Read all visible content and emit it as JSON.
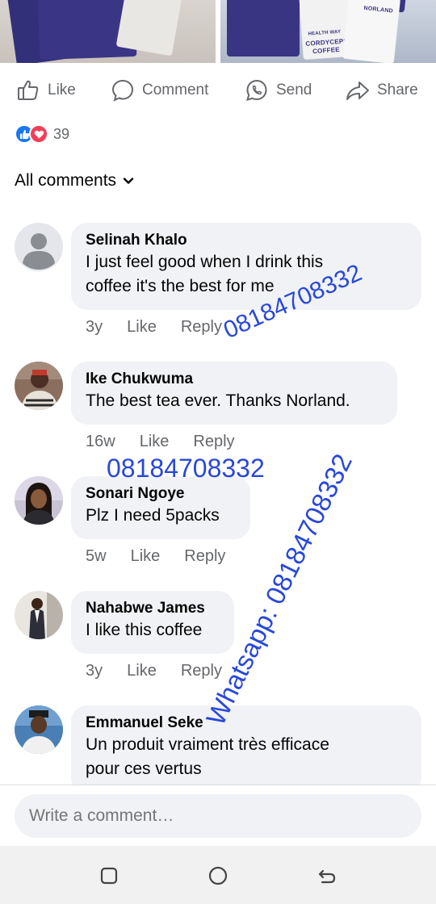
{
  "photos": {
    "right_pack_labels": [
      "NORLAND",
      "HEALTH WAY",
      "CORDYCEPS",
      "COFFEE"
    ]
  },
  "actions": {
    "like": "Like",
    "comment": "Comment",
    "send": "Send",
    "share": "Share"
  },
  "reactions": {
    "count": "39",
    "types": [
      "like",
      "love"
    ]
  },
  "comments_header": {
    "label": "All comments"
  },
  "comments": [
    {
      "name": "Selinah Khalo",
      "text_lines": [
        "I just feel good when I drink this",
        "coffee it's the best for me"
      ],
      "time": "3y",
      "like": "Like",
      "reply": "Reply",
      "avatar": "default-avatar-icon"
    },
    {
      "name": "Ike Chukwuma",
      "text_lines": [
        "The best tea ever. Thanks Norland."
      ],
      "time": "16w",
      "like": "Like",
      "reply": "Reply",
      "avatar": "photo"
    },
    {
      "name": "Sonari Ngoye",
      "text_lines": [
        "Plz I need 5packs"
      ],
      "time": "5w",
      "like": "Like",
      "reply": "Reply",
      "avatar": "photo"
    },
    {
      "name": "Nahabwe James",
      "text_lines": [
        "I like this coffee"
      ],
      "time": "3y",
      "like": "Like",
      "reply": "Reply",
      "avatar": "photo"
    },
    {
      "name": "Emmanuel Seke",
      "text_lines": [
        "Un produit vraiment très efficace",
        "pour ces vertus"
      ],
      "avatar": "photo"
    }
  ],
  "watermarks": {
    "phone_1": "08184708332",
    "phone_2": "08184708332",
    "whatsapp": "Whatsapp: 08184708332"
  },
  "composer": {
    "placeholder": "Write a comment…"
  },
  "colors": {
    "like_blue": "#1877f2",
    "love_red": "#f33e58",
    "watermark_blue": "#2948d8",
    "bubble_gray": "#f0f2f5",
    "secondary_text": "#65676b"
  }
}
